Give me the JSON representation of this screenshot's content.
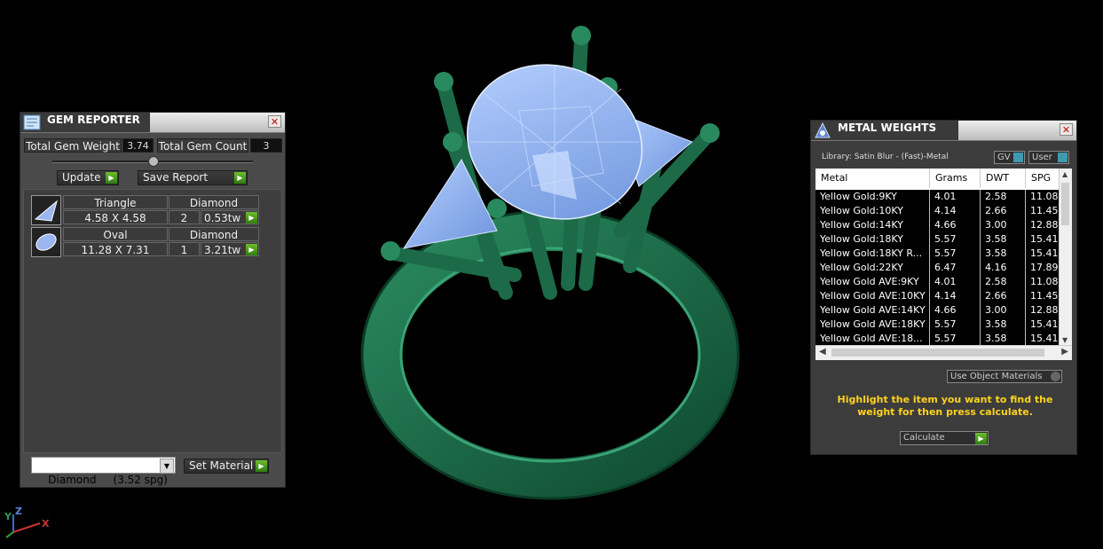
{
  "gem_reporter": {
    "title": "GEM REPORTER",
    "close_label": "✕",
    "total_weight_label": "Total Gem Weight",
    "total_weight_value": "3.74",
    "total_count_label": "Total Gem Count",
    "total_count_value": "3",
    "update_label": "Update",
    "save_report_label": "Save Report",
    "gems": [
      {
        "shape": "Triangle",
        "material": "Diamond",
        "size": "4.58 X 4.58",
        "count": "2",
        "weight": "0.53tw"
      },
      {
        "shape": "Oval",
        "material": "Diamond",
        "size": "11.28 X 7.31",
        "count": "1",
        "weight": "3.21tw"
      }
    ],
    "material_select": "Diamond     (3.52 spg)",
    "set_material_label": "Set Material"
  },
  "metal_weights": {
    "title": "METAL WEIGHTS",
    "close_label": "✕",
    "library": "Library: Satin Blur - (Fast)-Metal",
    "gv_label": "GV",
    "user_label": "User",
    "columns": [
      "Metal",
      "Grams",
      "DWT",
      "SPG"
    ],
    "rows": [
      [
        "Yellow Gold:9KY",
        "4.01",
        "2.58",
        "11.08"
      ],
      [
        "Yellow Gold:10KY",
        "4.14",
        "2.66",
        "11.45"
      ],
      [
        "Yellow Gold:14KY",
        "4.66",
        "3.00",
        "12.88"
      ],
      [
        "Yellow Gold:18KY",
        "5.57",
        "3.58",
        "15.41"
      ],
      [
        "Yellow Gold:18KY R...",
        "5.57",
        "3.58",
        "15.41"
      ],
      [
        "Yellow Gold:22KY",
        "6.47",
        "4.16",
        "17.89"
      ],
      [
        "Yellow Gold AVE:9KY",
        "4.01",
        "2.58",
        "11.08"
      ],
      [
        "Yellow Gold AVE:10KY",
        "4.14",
        "2.66",
        "11.45"
      ],
      [
        "Yellow Gold AVE:14KY",
        "4.66",
        "3.00",
        "12.88"
      ],
      [
        "Yellow Gold AVE:18KY",
        "5.57",
        "3.58",
        "15.41"
      ],
      [
        "Yellow Gold AVE:18...",
        "5.57",
        "3.58",
        "15.41"
      ]
    ],
    "use_object_materials": "Use Object Materials",
    "instruction": "Highlight the item you want to find the weight for then press calculate.",
    "calculate_label": "Calculate"
  },
  "axis_labels": {
    "y": "Y",
    "z": "Z",
    "x": "X"
  },
  "colors": {
    "ring": "#1f6b4a",
    "gem": "#8fb4f0",
    "instruction": "#ffd21e",
    "panel": "#4a4a4a"
  }
}
